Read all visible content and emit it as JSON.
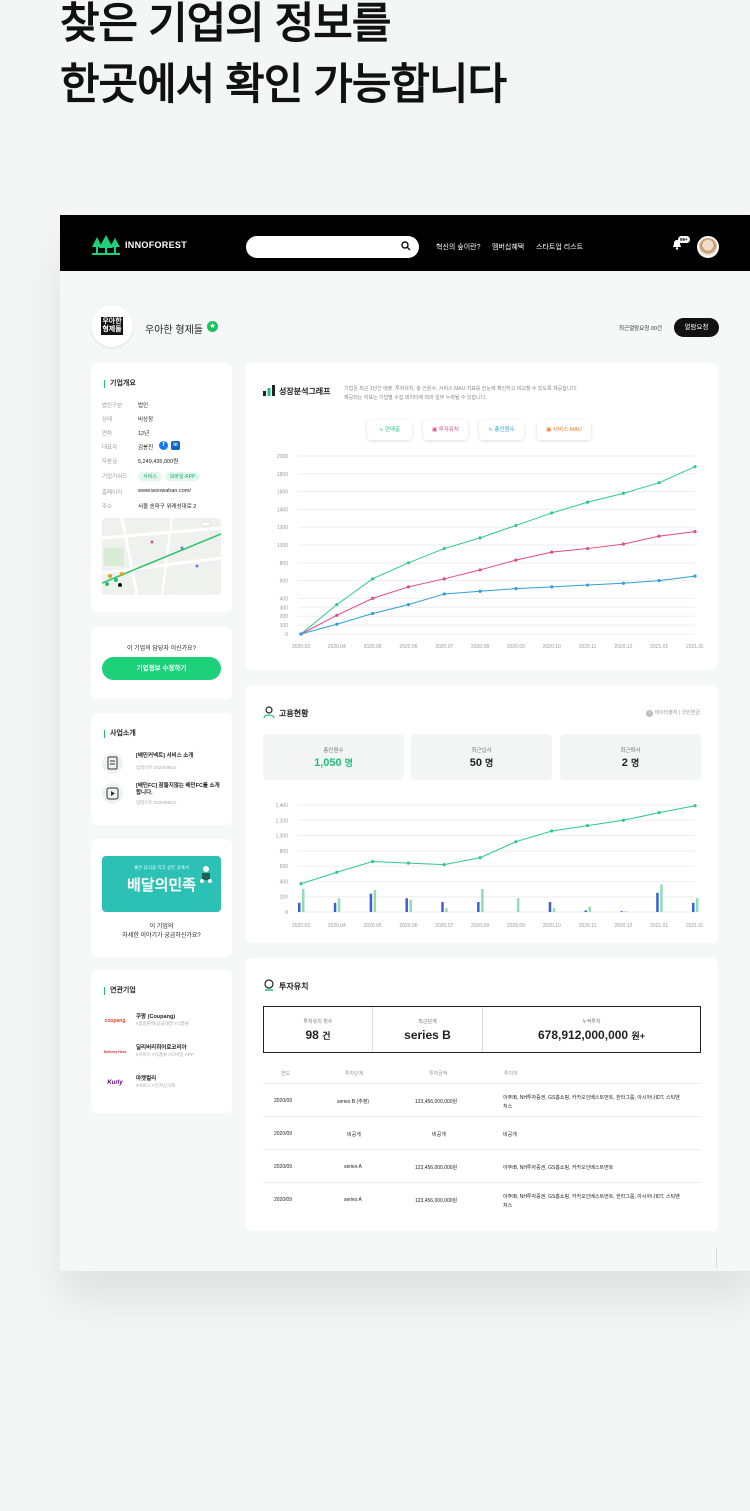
{
  "hero": {
    "line1": "찾은 기업의 정보를",
    "line2": "한곳에서 확인 가능합니다"
  },
  "nav": {
    "logo_text": "INNOFOREST",
    "search_placeholder": "",
    "menu": [
      "혁신의 숲이란?",
      "멤버십혜택",
      "스타트업 리스트"
    ],
    "badge": "99+"
  },
  "company": {
    "logo_text": "우아한형제들",
    "name": "우아한 형제들",
    "recent_count": "최근열람요청 00건",
    "request_button": "열람요청"
  },
  "overview": {
    "title": "기업개요",
    "rows": [
      {
        "k": "법인구분",
        "v": "법인"
      },
      {
        "k": "상태",
        "v": "비상장"
      },
      {
        "k": "연차",
        "v": "12년"
      },
      {
        "k": "대표자",
        "v": "김봉진"
      },
      {
        "k": "자본금",
        "v": "5,249,435,000원"
      },
      {
        "k": "기업키워드",
        "v": ""
      },
      {
        "k": "홈페이지",
        "v": "www.woowahan.com/"
      },
      {
        "k": "주소",
        "v": "서울 송파구 위례성대로 2"
      }
    ],
    "keywords": [
      "서비스",
      "모바일·APP"
    ]
  },
  "manager": {
    "question": "이 기업의 담당자 이신가요?",
    "button": "기업정보 수정하기"
  },
  "business": {
    "title": "사업소개",
    "items": [
      {
        "title": "[배민커넥트] 서비스 소개",
        "date": "업데이트 2020/09/10"
      },
      {
        "title": "[배민FC] 잠들지않는 배민FC를 소개합니다.",
        "date": "업데이트 2020/09/10"
      }
    ]
  },
  "ad": {
    "banner_small": "좋은 음식을 먹고 싶은 곳에서",
    "banner_big": "배달의민족",
    "line1": "이 기업의",
    "line2": "자세한 이야기가 궁금하신가요?"
  },
  "related": {
    "title": "연관기업",
    "items": [
      {
        "logo": "coupang",
        "name": "쿠팡 (Coupang)",
        "tags": "#종합판매/공급대행 #식품류"
      },
      {
        "logo": "Delivery Hero",
        "name": "딜리버리히어로코리아",
        "tags": "#서비스 #식품류 #모바일·APP"
      },
      {
        "logo": "Kurly",
        "name": "마켓컬리",
        "tags": "#서비스 #전자상거래"
      }
    ]
  },
  "growth": {
    "title": "성장분석그래프",
    "desc1": "기업은 최근 3년간 매출, 투자유치, 총 인원수, 서비스 MAU 지표를 한눈에 확인하고 비교할 수 있도록 제공합니다.",
    "desc2": "제공되는 지표는 기업별 수집 데이터에 따라 일부 누락될 수 있습니다.",
    "legend": [
      "연매출",
      "투자유치",
      "총인원수",
      "서비스 MAU"
    ],
    "colors": {
      "green": "#2ec98a",
      "pink": "#e04a8a",
      "blue": "#2f9fd8",
      "orange": "#f07b2f"
    }
  },
  "employment": {
    "title": "고용현황",
    "source": "데이터출처 | 국민연금",
    "stats": [
      {
        "label": "총인원수",
        "value": "1,050",
        "unit": "명"
      },
      {
        "label": "최근입사",
        "value": "50",
        "unit": "명"
      },
      {
        "label": "최근퇴사",
        "value": "2",
        "unit": "명"
      }
    ]
  },
  "investment": {
    "title": "투자유치",
    "summary": [
      {
        "label": "투자유치 횟수",
        "value": "98",
        "unit": "건"
      },
      {
        "label": "최근단계",
        "value": "series B",
        "unit": ""
      },
      {
        "label": "누적투자",
        "value": "678,912,000,000",
        "unit": "원+"
      }
    ],
    "headers": [
      "연도",
      "투자단계",
      "투자금액",
      "투자자"
    ],
    "rows": [
      {
        "year": "2020/09",
        "stage": "series B (추정)",
        "amount": "123,456,000,000원",
        "investors": "아주IB, NH투자증권, GS홈쇼핑, 카카오인베스트먼트, 한라그룹, 아시아나IDT, 스틱벤처스"
      },
      {
        "year": "2020/09",
        "stage": "비공개",
        "amount": "비공개",
        "investors": "비공개"
      },
      {
        "year": "2020/09",
        "stage": "series A",
        "amount": "123,456,000,000원",
        "investors": "아주IB, NH투자증권, GS홈쇼핑, 카카오인베스트먼트"
      },
      {
        "year": "2020/09",
        "stage": "series A",
        "amount": "123,456,000,000원",
        "investors": "아주IB, NH투자증권, GS홈쇼핑, 카카오인베스트먼트, 한라그룹, 아시아나IDT, 스틱벤처스"
      }
    ]
  },
  "chart_data": [
    {
      "type": "line",
      "x": [
        "2020.03",
        "2020.04",
        "2020.05",
        "2020.06",
        "2020.07",
        "2020.08",
        "2020.09",
        "2020.10",
        "2020.11",
        "2020.12",
        "2021.01",
        "2021.02"
      ],
      "yticks": [
        "2000",
        "1800",
        "1600",
        "1400",
        "1200",
        "1000",
        "800",
        "600",
        "400",
        "300",
        "200",
        "100",
        "0"
      ],
      "ylim": [
        0,
        2000
      ],
      "series": [
        {
          "name": "연매출",
          "color": "#2ec98a",
          "values": [
            0,
            330,
            620,
            800,
            960,
            1080,
            1220,
            1360,
            1480,
            1580,
            1700,
            1880
          ]
        },
        {
          "name": "투자유치",
          "color": "#e04a8a",
          "values": [
            0,
            210,
            400,
            530,
            620,
            720,
            830,
            920,
            960,
            1010,
            1100,
            1150
          ]
        },
        {
          "name": "총인원수",
          "color": "#2f9fd8",
          "values": [
            0,
            110,
            230,
            330,
            450,
            480,
            510,
            530,
            550,
            570,
            600,
            650
          ]
        }
      ]
    },
    {
      "type": "bar+line",
      "x": [
        "2020.03",
        "2020.04",
        "2020.05",
        "2020.06",
        "2020.07",
        "2020.08",
        "2020.09",
        "2020.10",
        "2020.11",
        "2020.12",
        "2021.01",
        "2021.02"
      ],
      "yticks": [
        "1,400",
        "1,200",
        "1,000",
        "800",
        "600",
        "400",
        "200",
        "0"
      ],
      "ylim": [
        0,
        1400
      ],
      "line": {
        "color": "#2ec98a",
        "values": [
          370,
          520,
          660,
          640,
          620,
          710,
          920,
          1060,
          1130,
          1200,
          1300,
          1390
        ]
      },
      "bars": [
        {
          "name": "입사",
          "color": "#3a5fd6",
          "values": [
            120,
            120,
            240,
            180,
            130,
            130,
            0,
            130,
            20,
            10,
            250,
            120
          ]
        },
        {
          "name": "퇴사",
          "color": "#8fdcb5",
          "values": [
            300,
            180,
            290,
            160,
            50,
            300,
            180,
            50,
            70,
            10,
            360,
            180
          ]
        }
      ]
    }
  ]
}
